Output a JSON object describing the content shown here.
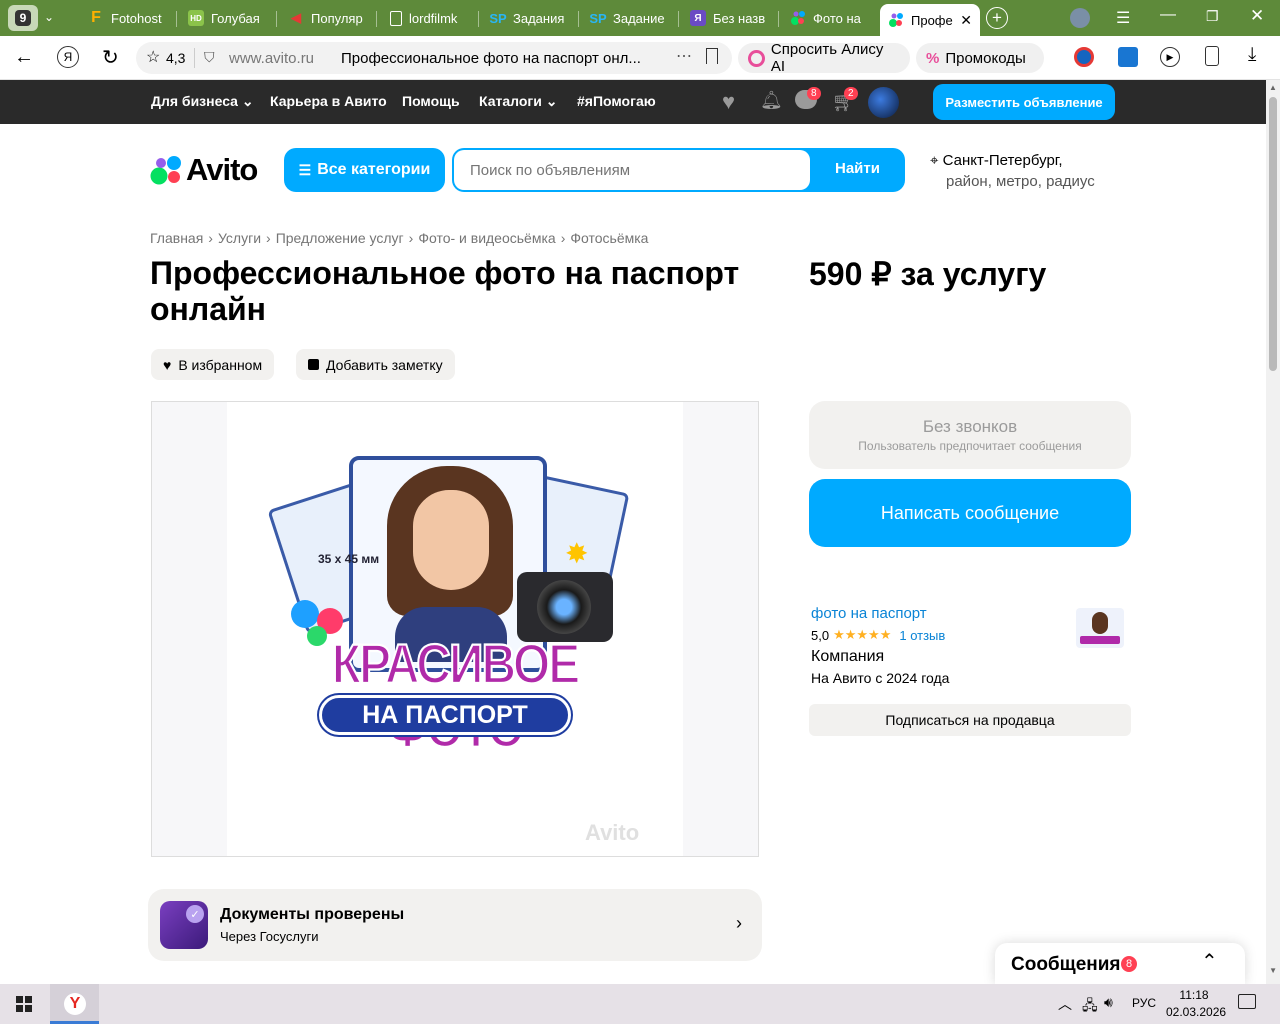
{
  "browser": {
    "tab_count": "9",
    "tabs": [
      {
        "title": "Fotohost",
        "fav": "F",
        "color": "#ffb000"
      },
      {
        "title": "Голубая",
        "fav": "HD",
        "color": "#8bc34a"
      },
      {
        "title": "Популяр",
        "fav": "▶",
        "color": "#e53935"
      },
      {
        "title": "lordfilmk",
        "fav": "",
        "color": "#ffffff"
      },
      {
        "title": "Задания",
        "fav": "SP",
        "color": "#29b6f6"
      },
      {
        "title": "Задание",
        "fav": "SP",
        "color": "#29b6f6"
      },
      {
        "title": "Без назв",
        "fav": "Я",
        "color": "#6a4bc4"
      },
      {
        "title": "Фото на",
        "fav": "",
        "color": "#00aaff"
      },
      {
        "title": "Профе",
        "fav": "",
        "color": "#00aaff"
      }
    ],
    "rating": "4,3",
    "domain": "www.avito.ru",
    "page_title": "Профессиональное фото на паспорт онл...",
    "alice_label": "Спросить Алису AI",
    "promo_label": "Промокоды"
  },
  "nav": {
    "business": "Для бизнеса",
    "career": "Карьера в Авито",
    "help": "Помощь",
    "catalogs": "Каталоги",
    "pomogayu": "#яПомогаю",
    "messages_badge": "8",
    "cart_badge": "2",
    "post_ad": "Разместить объявление"
  },
  "header": {
    "logo": "Avito",
    "categories": "Все категории",
    "search_placeholder": "Поиск по объявлениям",
    "search_button": "Найти",
    "city": "Санкт-Петербург,",
    "city_sub": "район, метро, радиус"
  },
  "breadcrumbs": [
    "Главная",
    "Услуги",
    "Предложение услуг",
    "Фото- и видеосьёмка",
    "Фотосьёмка"
  ],
  "listing": {
    "title_line1": "Профессиональное фото на паспорт",
    "title_line2": "онлайн",
    "price": "590 ₽ за услугу",
    "fav_label": "В избранном",
    "note_label": "Добавить заметку",
    "image_text1": "КРАСИВОЕ ФОТО",
    "image_text2": "НА ПАСПОРТ",
    "image_size": "35 x 45 мм",
    "watermark": "Avito"
  },
  "seller": {
    "no_calls": "Без звонков",
    "no_calls_sub": "Пользователь предпочитает сообщения",
    "write": "Написать сообщение",
    "name": "фото на паспорт",
    "rating": "5,0",
    "stars": "★★★★★",
    "reviews": "1 отзыв",
    "type": "Компания",
    "since": "На Авито с 2024 года",
    "subscribe": "Подписаться на продавца"
  },
  "docs": {
    "title": "Документы проверены",
    "sub": "Через Госуслуги"
  },
  "messages_panel": {
    "label": "Сообщения",
    "badge": "8"
  },
  "taskbar": {
    "lang": "РУС",
    "time": "11:18",
    "date": "02.03.2026"
  }
}
